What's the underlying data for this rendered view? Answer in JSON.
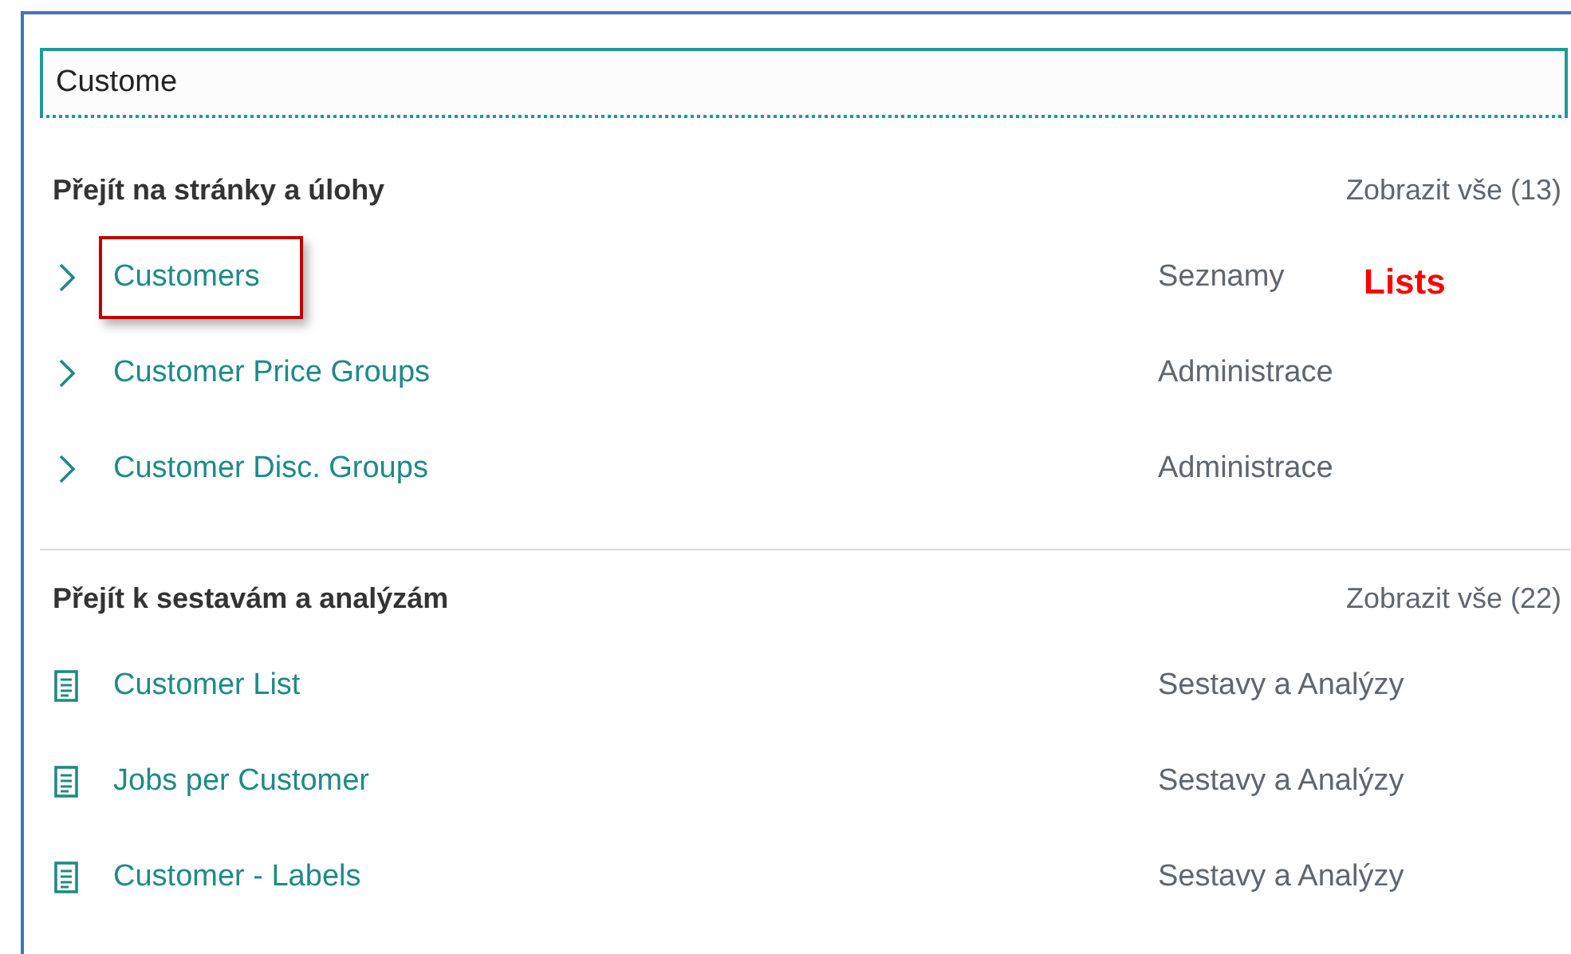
{
  "search": {
    "value": "Custome"
  },
  "sections": [
    {
      "title": "Přejít na stránky a úlohy",
      "show_all": "Zobrazit vše (13)",
      "items": [
        {
          "kind": "page",
          "name": "Customers",
          "category": "Seznamy",
          "highlighted": true,
          "annotation": "Lists"
        },
        {
          "kind": "page",
          "name": "Customer Price Groups",
          "category": "Administrace",
          "highlighted": false
        },
        {
          "kind": "page",
          "name": "Customer Disc. Groups",
          "category": "Administrace",
          "highlighted": false
        }
      ]
    },
    {
      "title": "Přejít k sestavám a analýzám",
      "show_all": "Zobrazit vše (22)",
      "items": [
        {
          "kind": "report",
          "name": "Customer List",
          "category": "Sestavy a Analýzy",
          "highlighted": false
        },
        {
          "kind": "report",
          "name": "Jobs per Customer",
          "category": "Sestavy a Analýzy",
          "highlighted": false
        },
        {
          "kind": "report",
          "name": "Customer - Labels",
          "category": "Sestavy a Analýzy",
          "highlighted": false
        }
      ]
    }
  ]
}
